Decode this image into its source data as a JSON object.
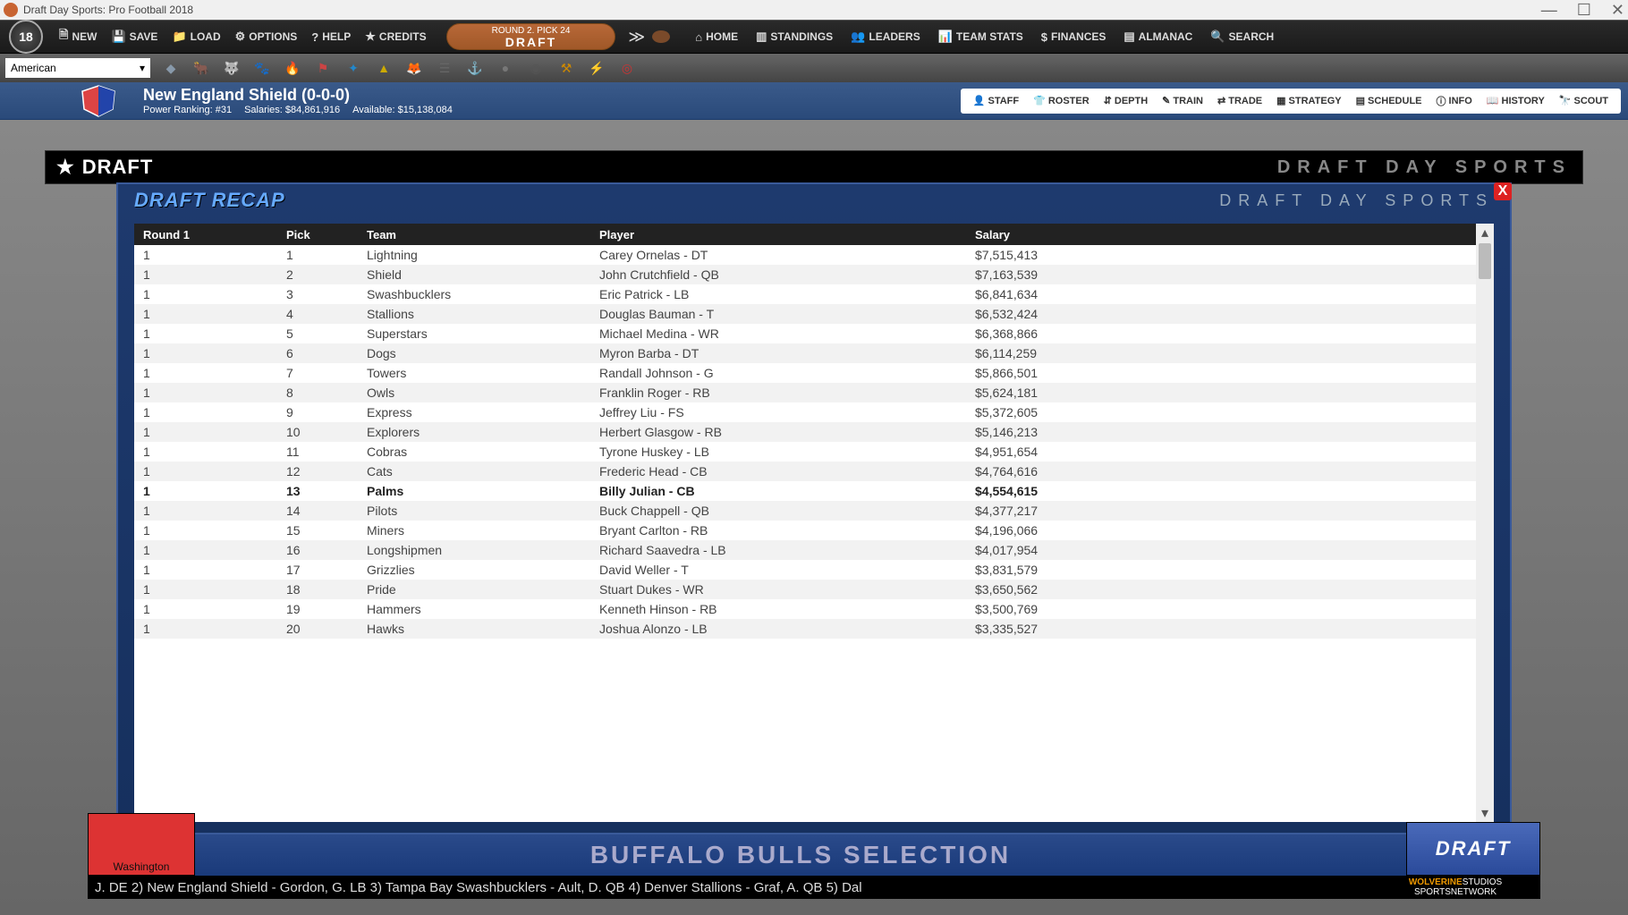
{
  "window": {
    "title": "Draft Day Sports: Pro Football 2018"
  },
  "ribbon": {
    "logo": "18",
    "left": {
      "new": "NEW",
      "save": "SAVE",
      "load": "LOAD",
      "options": "OPTIONS",
      "help": "HELP",
      "credits": "CREDITS"
    },
    "draft_pill": {
      "top": "ROUND 2. PICK 24",
      "bottom": "DRAFT"
    },
    "right": {
      "home": "HOME",
      "standings": "STANDINGS",
      "leaders": "LEADERS",
      "teamstats": "TEAM STATS",
      "finances": "FINANCES",
      "almanac": "ALMANAC",
      "search": "SEARCH"
    }
  },
  "league_select": "American",
  "team": {
    "name": "New England Shield (0-0-0)",
    "power": "Power Ranking: #31",
    "salaries": "Salaries: $84,861,916",
    "available": "Available: $15,138,084"
  },
  "teamnav": {
    "staff": "STAFF",
    "roster": "ROSTER",
    "depth": "DEPTH",
    "train": "TRAIN",
    "trade": "TRADE",
    "strategy": "STRATEGY",
    "schedule": "SCHEDULE",
    "info": "INFO",
    "history": "HISTORY",
    "scout": "SCOUT"
  },
  "panel": {
    "title": "DRAFT",
    "brand": "DRAFT DAY SPORTS"
  },
  "recap": {
    "title": "DRAFT RECAP",
    "brand": "DRAFT DAY SPORTS"
  },
  "columns": {
    "round": "Round 1",
    "pick": "Pick",
    "team": "Team",
    "player": "Player",
    "salary": "Salary"
  },
  "rows": [
    {
      "round": "1",
      "pick": "1",
      "team": "Lightning",
      "player": "Carey Ornelas - DT",
      "salary": "$7,515,413",
      "bold": false
    },
    {
      "round": "1",
      "pick": "2",
      "team": "Shield",
      "player": "John Crutchfield - QB",
      "salary": "$7,163,539",
      "bold": false
    },
    {
      "round": "1",
      "pick": "3",
      "team": "Swashbucklers",
      "player": "Eric Patrick - LB",
      "salary": "$6,841,634",
      "bold": false
    },
    {
      "round": "1",
      "pick": "4",
      "team": "Stallions",
      "player": "Douglas Bauman - T",
      "salary": "$6,532,424",
      "bold": false
    },
    {
      "round": "1",
      "pick": "5",
      "team": "Superstars",
      "player": "Michael Medina - WR",
      "salary": "$6,368,866",
      "bold": false
    },
    {
      "round": "1",
      "pick": "6",
      "team": "Dogs",
      "player": "Myron Barba - DT",
      "salary": "$6,114,259",
      "bold": false
    },
    {
      "round": "1",
      "pick": "7",
      "team": "Towers",
      "player": "Randall Johnson - G",
      "salary": "$5,866,501",
      "bold": false
    },
    {
      "round": "1",
      "pick": "8",
      "team": "Owls",
      "player": "Franklin Roger - RB",
      "salary": "$5,624,181",
      "bold": false
    },
    {
      "round": "1",
      "pick": "9",
      "team": "Express",
      "player": "Jeffrey Liu - FS",
      "salary": "$5,372,605",
      "bold": false
    },
    {
      "round": "1",
      "pick": "10",
      "team": "Explorers",
      "player": "Herbert Glasgow - RB",
      "salary": "$5,146,213",
      "bold": false
    },
    {
      "round": "1",
      "pick": "11",
      "team": "Cobras",
      "player": "Tyrone Huskey - LB",
      "salary": "$4,951,654",
      "bold": false
    },
    {
      "round": "1",
      "pick": "12",
      "team": "Cats",
      "player": "Frederic Head - CB",
      "salary": "$4,764,616",
      "bold": false
    },
    {
      "round": "1",
      "pick": "13",
      "team": "Palms",
      "player": "Billy Julian - CB",
      "salary": "$4,554,615",
      "bold": true
    },
    {
      "round": "1",
      "pick": "14",
      "team": "Pilots",
      "player": "Buck Chappell - QB",
      "salary": "$4,377,217",
      "bold": false
    },
    {
      "round": "1",
      "pick": "15",
      "team": "Miners",
      "player": "Bryant Carlton - RB",
      "salary": "$4,196,066",
      "bold": false
    },
    {
      "round": "1",
      "pick": "16",
      "team": "Longshipmen",
      "player": "Richard Saavedra - LB",
      "salary": "$4,017,954",
      "bold": false
    },
    {
      "round": "1",
      "pick": "17",
      "team": "Grizzlies",
      "player": "David Weller - T",
      "salary": "$3,831,579",
      "bold": false
    },
    {
      "round": "1",
      "pick": "18",
      "team": "Pride",
      "player": "Stuart Dukes - WR",
      "salary": "$3,650,562",
      "bold": false
    },
    {
      "round": "1",
      "pick": "19",
      "team": "Hammers",
      "player": "Kenneth Hinson - RB",
      "salary": "$3,500,769",
      "bold": false
    },
    {
      "round": "1",
      "pick": "20",
      "team": "Hawks",
      "player": "Joshua Alonzo - LB",
      "salary": "$3,335,527",
      "bold": false
    }
  ],
  "selection": {
    "team_card": "Washington",
    "headline": "BUFFALO BULLS SELECTION",
    "box": "DRAFT"
  },
  "ticker": "J. DE    2) New England Shield - Gordon, G. LB    3) Tampa Bay Swashbucklers - Ault, D. QB    4) Denver Stallions - Graf, A. QB    5) Dal",
  "network": {
    "l1a": "WOLVERINE",
    "l1b": "STUDIOS",
    "l2": "SPORTSNETWORK"
  }
}
